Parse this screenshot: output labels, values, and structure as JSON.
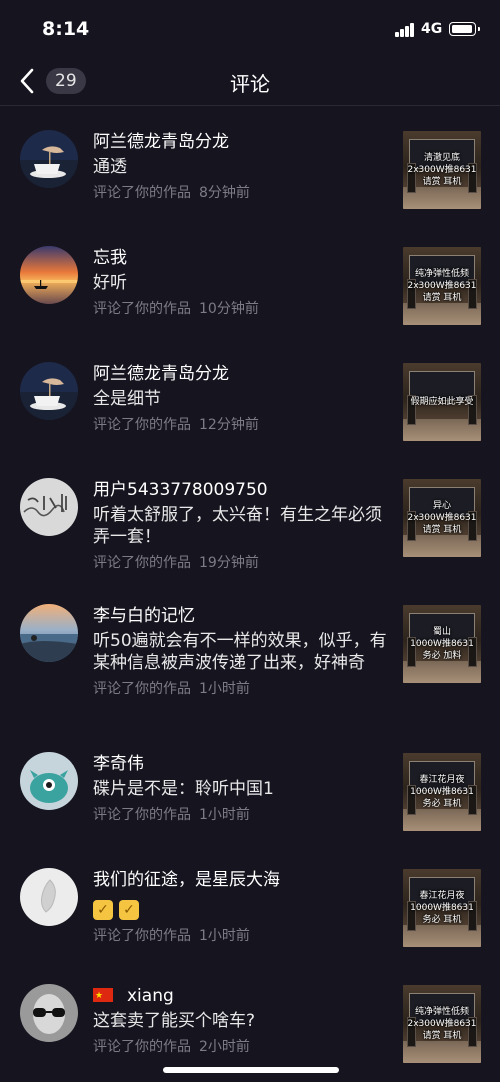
{
  "status_bar": {
    "time": "8:14",
    "network": "4G"
  },
  "nav": {
    "back_count": "29",
    "title": "评论"
  },
  "comments": [
    {
      "username": "阿兰德龙青岛分龙",
      "comment": "通透",
      "action": "评论了你的作品",
      "time": "8分钟前",
      "thumb_lines": [
        "清澈见底",
        "2x300W推8631",
        "请赏    耳机"
      ]
    },
    {
      "username": "忘我",
      "comment": "好听",
      "action": "评论了你的作品",
      "time": "10分钟前",
      "thumb_lines": [
        "纯净弹性低频",
        "2x300W推8631",
        "请赏    耳机"
      ]
    },
    {
      "username": "阿兰德龙青岛分龙",
      "comment": "全是细节",
      "action": "评论了你的作品",
      "time": "12分钟前",
      "thumb_lines": [
        "假期应如此享受"
      ]
    },
    {
      "username": "用户5433778009750",
      "comment": "听着太舒服了，太兴奋！有生之年必须弄一套！",
      "action": "评论了你的作品",
      "time": "19分钟前",
      "thumb_lines": [
        "异心",
        "2x300W推8631",
        "请赏    耳机"
      ]
    },
    {
      "username": "李与白的记忆",
      "comment": "听50遍就会有不一样的效果，似乎，有某种信息被声波传递了出来，好神奇",
      "action": "评论了你的作品",
      "time": "1小时前",
      "thumb_lines": [
        "蜀山",
        "1000W推8631",
        "务必    加料"
      ]
    },
    {
      "username": "李奇伟",
      "comment": "碟片是不是：聆听中国1",
      "action": "评论了你的作品",
      "time": "1小时前",
      "thumb_lines": [
        "春江花月夜",
        "1000W推8631",
        "务必    耳机"
      ]
    },
    {
      "username": "我们的征途，是星辰大海",
      "comment": "👍👍",
      "action": "评论了你的作品",
      "time": "1小时前",
      "thumb_lines": [
        "春江花月夜",
        "1000W推8631",
        "务必    耳机"
      ]
    },
    {
      "username": "xiang",
      "comment": "这套卖了能买个啥车?",
      "action": "评论了你的作品",
      "time": "2小时前",
      "thumb_lines": [
        "纯净弹性低频",
        "2x300W推8631",
        "请赏    耳机"
      ]
    }
  ],
  "avatars": [
    "coffee-hand-icon",
    "sunset-boat-icon",
    "coffee-hand-icon",
    "handwriting-icon",
    "lake-sunset-icon",
    "teal-monster-icon",
    "white-sculpture-icon",
    "sunglasses-man-icon"
  ],
  "colors": {
    "background": "#16141f",
    "meta_text": "#7d7b86",
    "badge": "#3a3844"
  }
}
